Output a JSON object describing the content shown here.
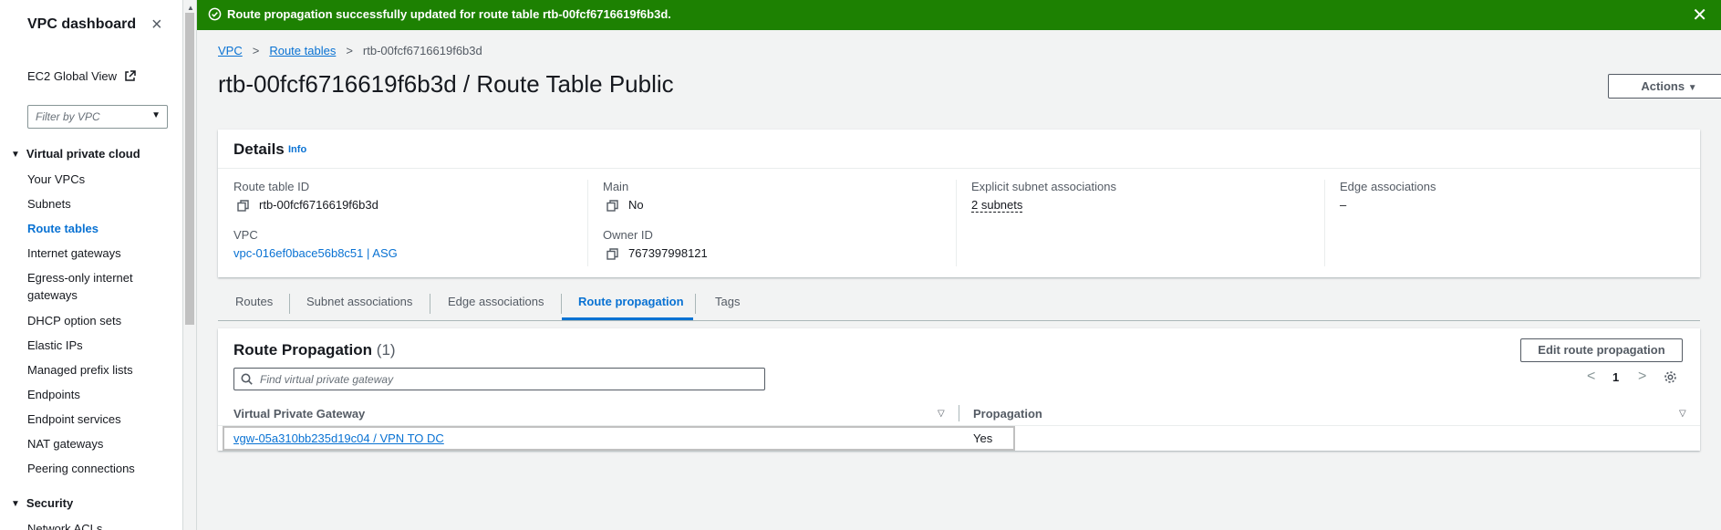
{
  "sidebar": {
    "title": "VPC dashboard",
    "close_icon": "×",
    "ec2_global_view": "EC2 Global View",
    "filter_placeholder": "Filter by VPC",
    "section_vpc": "Virtual private cloud",
    "items": [
      {
        "label": "Your VPCs",
        "active": false
      },
      {
        "label": "Subnets",
        "active": false
      },
      {
        "label": "Route tables",
        "active": true
      },
      {
        "label": "Internet gateways",
        "active": false
      },
      {
        "label": "Egress-only internet gateways",
        "active": false
      },
      {
        "label": "DHCP option sets",
        "active": false
      },
      {
        "label": "Elastic IPs",
        "active": false
      },
      {
        "label": "Managed prefix lists",
        "active": false
      },
      {
        "label": "Endpoints",
        "active": false
      },
      {
        "label": "Endpoint services",
        "active": false
      },
      {
        "label": "NAT gateways",
        "active": false
      },
      {
        "label": "Peering connections",
        "active": false
      }
    ],
    "section_security": "Security",
    "security_items": [
      {
        "label": "Network ACLs"
      }
    ]
  },
  "flash": {
    "message": "Route propagation successfully updated for route table rtb-00fcf6716619f6b3d.",
    "status_color": "#1d8102"
  },
  "breadcrumb": {
    "vpc": "VPC",
    "route_tables": "Route tables",
    "current": "rtb-00fcf6716619f6b3d"
  },
  "page": {
    "title": "rtb-00fcf6716619f6b3d / Route Table Public",
    "actions_label": "Actions"
  },
  "details": {
    "heading": "Details",
    "info_link": "Info",
    "route_table_id_label": "Route table ID",
    "route_table_id": "rtb-00fcf6716619f6b3d",
    "vpc_label": "VPC",
    "vpc_value": "vpc-016ef0bace56b8c51 | ASG",
    "main_label": "Main",
    "main_value": "No",
    "owner_id_label": "Owner ID",
    "owner_id": "767397998121",
    "explicit_label": "Explicit subnet associations",
    "explicit_value": "2 subnets",
    "edge_label": "Edge associations",
    "edge_value": "–"
  },
  "tabs": [
    {
      "label": "Routes",
      "active": false
    },
    {
      "label": "Subnet associations",
      "active": false
    },
    {
      "label": "Edge associations",
      "active": false
    },
    {
      "label": "Route propagation",
      "active": true
    },
    {
      "label": "Tags",
      "active": false
    }
  ],
  "route_propagation": {
    "title": "Route Propagation",
    "count": "(1)",
    "edit_label": "Edit route propagation",
    "search_placeholder": "Find virtual private gateway",
    "page_number": "1",
    "columns": [
      "Virtual Private Gateway",
      "Propagation"
    ],
    "rows": [
      {
        "gateway": "vgw-05a310bb235d19c04 / VPN TO DC",
        "propagation": "Yes"
      }
    ]
  },
  "colors": {
    "accent": "#0972d3",
    "success": "#1d8102"
  }
}
